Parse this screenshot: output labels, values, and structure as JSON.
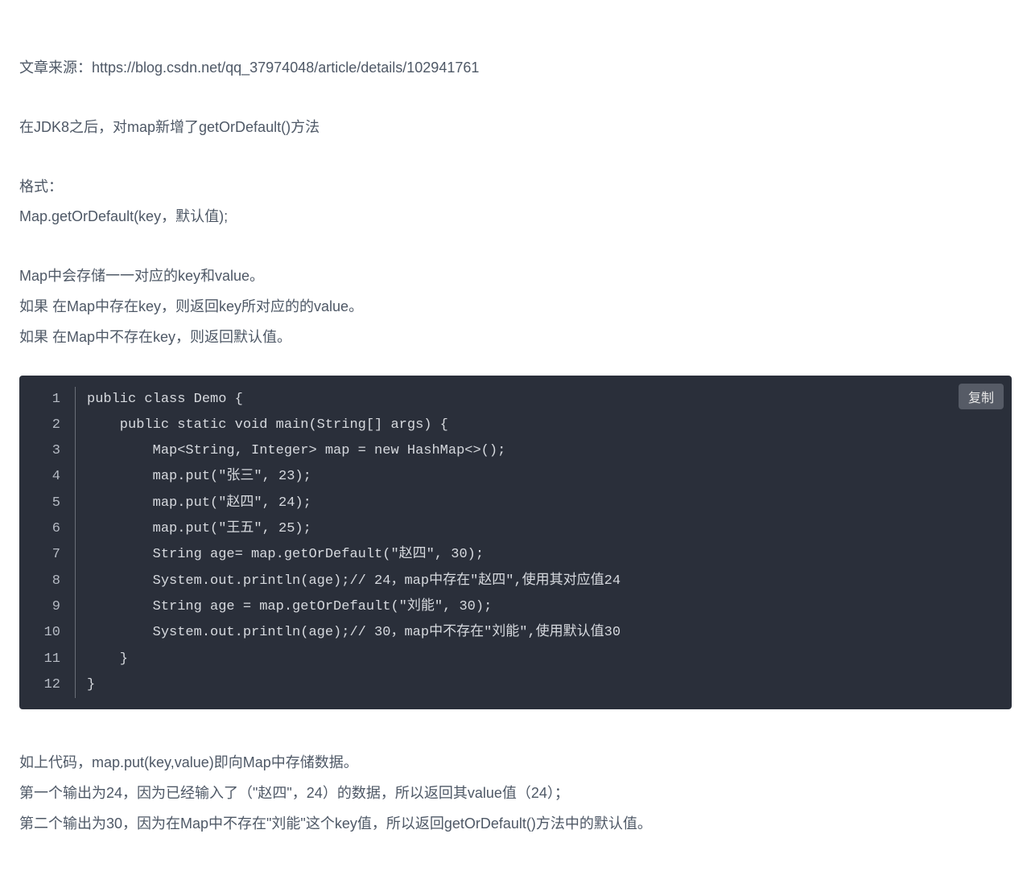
{
  "article": {
    "source": "文章来源：https://blog.csdn.net/qq_37974048/article/details/102941761",
    "intro": "在JDK8之后，对map新增了getOrDefault()方法",
    "format_label": "格式：",
    "format_line": "Map.getOrDefault(key，默认值);",
    "desc1": "Map中会存储一一对应的key和value。",
    "desc2": "如果 在Map中存在key，则返回key所对应的的value。",
    "desc3": "如果 在Map中不存在key，则返回默认值。",
    "after1": "如上代码，map.put(key,value)即向Map中存储数据。",
    "after2": "第一个输出为24，因为已经输入了（\"赵四\"，24）的数据，所以返回其value值（24）；",
    "after3": "第二个输出为30，因为在Map中不存在\"刘能\"这个key值，所以返回getOrDefault()方法中的默认值。"
  },
  "code": {
    "copy_label": "复制",
    "lines": [
      "public class Demo {",
      "    public static void main(String[] args) {",
      "        Map<String, Integer> map = new HashMap<>();",
      "        map.put(\"张三\", 23);",
      "        map.put(\"赵四\", 24);",
      "        map.put(\"王五\", 25);",
      "        String age= map.getOrDefault(\"赵四\", 30);",
      "        System.out.println(age);// 24，map中存在\"赵四\",使用其对应值24",
      "        String age = map.getOrDefault(\"刘能\", 30);",
      "        System.out.println(age);// 30，map中不存在\"刘能\",使用默认值30",
      "    }",
      "}"
    ]
  }
}
